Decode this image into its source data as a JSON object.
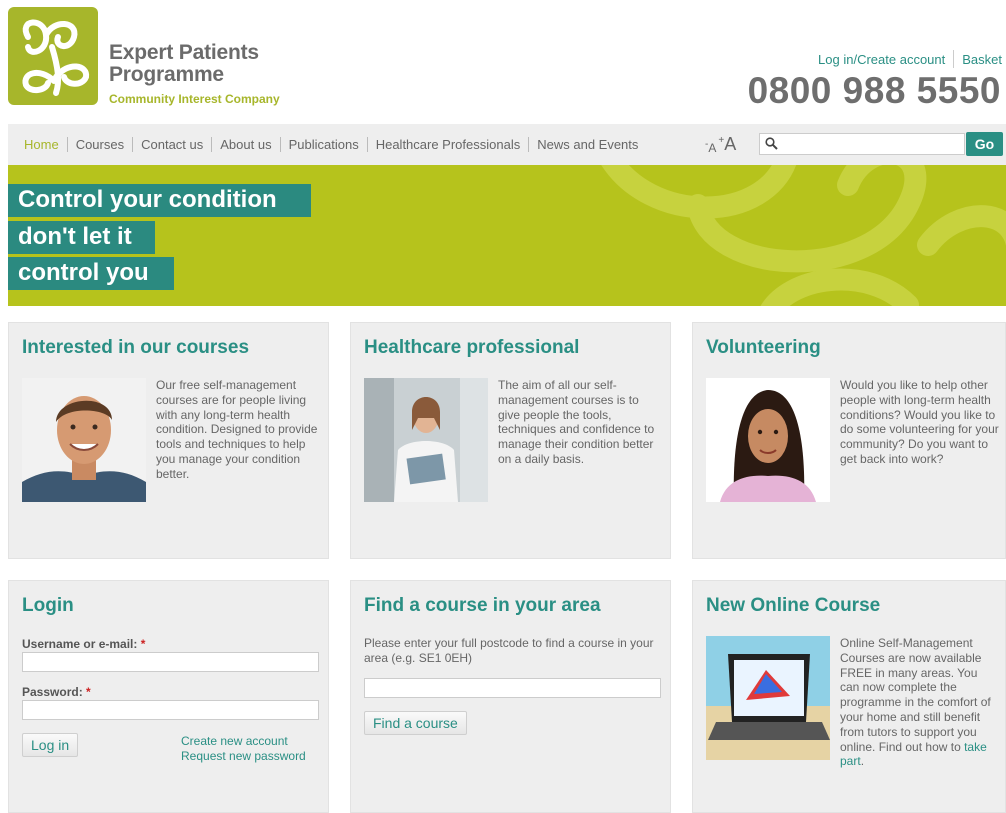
{
  "header": {
    "logo_line1": "Expert Patients",
    "logo_line2": "Programme",
    "logo_sub": "Community Interest Company",
    "login_link": "Log in/Create account",
    "basket_link": "Basket",
    "phone": "0800 988 5550"
  },
  "nav": {
    "items": [
      "Home",
      "Courses",
      "Contact us",
      "About us",
      "Publications",
      "Healthcare Professionals",
      "News and Events"
    ],
    "text_small": "A",
    "text_large": "A",
    "search_placeholder": "",
    "go_label": "Go"
  },
  "banner": {
    "line1": "Control your condition",
    "line2": "don't let it",
    "line3": "control you"
  },
  "panels": {
    "courses": {
      "title": "Interested in our courses",
      "text": "Our free self-management courses are for people living with any long-term health condition. Designed to provide tools and techniques to help you manage your condition better."
    },
    "healthcare": {
      "title": "Healthcare professional",
      "text": "The aim of all our self-management courses is to give people the tools, techniques and confidence to manage their condition better on a daily basis."
    },
    "volunteering": {
      "title": "Volunteering",
      "text": "Would you like to help other people with long-term health conditions? Would you like to do some volunteering for your community? Do you want to get back into work?"
    },
    "login": {
      "title": "Login",
      "username_label": "Username or e-mail:",
      "password_label": "Password:",
      "required": "*",
      "button": "Log in",
      "create_link": "Create new account",
      "request_link": "Request new password"
    },
    "find": {
      "title": "Find a course in your area",
      "text": "Please enter your full postcode to find a course in your area (e.g. SE1 0EH)",
      "button": "Find a course"
    },
    "online": {
      "title": "New Online Course",
      "text": "Online Self-Management Courses are now available FREE in many areas. You can now complete the programme in the comfort of your home and still benefit from tutors to support you online. Find out how to",
      "link": "take part",
      "end": "."
    }
  },
  "colors": {
    "brand_green": "#a7b62b",
    "teal": "#2a8f84",
    "banner": "#b6c31c",
    "panel_bg": "#eeeeee"
  }
}
